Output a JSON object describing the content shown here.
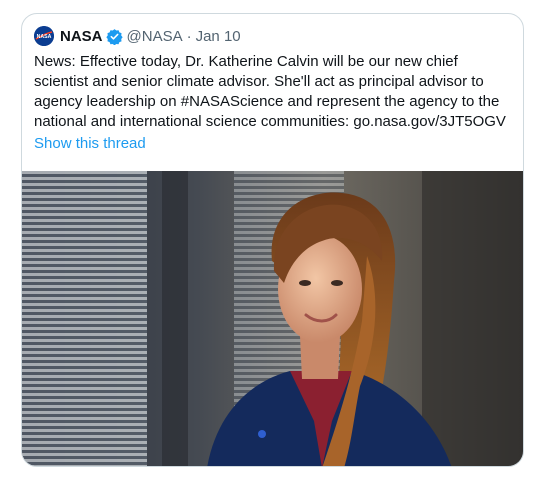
{
  "tweet": {
    "author_name": "NASA",
    "handle": "@NASA",
    "separator": "·",
    "date": "Jan 10",
    "avatar_label": "NASA",
    "text": "News: Effective today, Dr. Katherine Calvin will be our new chief\nscientist and senior climate advisor. She'll act as principal advisor to\nagency leadership on #NASAScience and represent the agency to the\nnational and international science communities: go.nasa.gov/3JT5OGV",
    "show_thread": "Show this thread"
  },
  "icons": {
    "verified": "verified-badge-icon",
    "avatar": "nasa-meatball-logo"
  },
  "colors": {
    "link": "#1d9bf0",
    "secondary_text": "#536471",
    "verified": "#1d9bf0",
    "border": "#cfd9de"
  }
}
